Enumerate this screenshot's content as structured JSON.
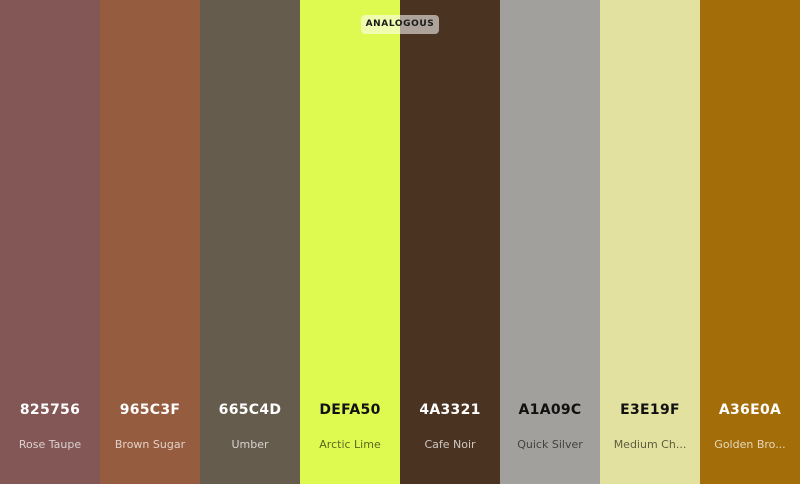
{
  "badge": {
    "label": "ANALOGOUS"
  },
  "swatches": [
    {
      "hex": "825756",
      "name": "Rose Taupe",
      "color": "#825756",
      "text": "#ffffff",
      "subtext": "rgba(255,255,255,0.72)"
    },
    {
      "hex": "965C3F",
      "name": "Brown Sugar",
      "color": "#965C3F",
      "text": "#ffffff",
      "subtext": "rgba(255,255,255,0.72)"
    },
    {
      "hex": "665C4D",
      "name": "Umber",
      "color": "#665C4D",
      "text": "#ffffff",
      "subtext": "rgba(255,255,255,0.72)"
    },
    {
      "hex": "DEFA50",
      "name": "Arctic Lime",
      "color": "#DEFA50",
      "text": "#111111",
      "subtext": "rgba(0,0,0,0.6)"
    },
    {
      "hex": "4A3321",
      "name": "Cafe Noir",
      "color": "#4A3321",
      "text": "#ffffff",
      "subtext": "rgba(255,255,255,0.72)"
    },
    {
      "hex": "A1A09C",
      "name": "Quick Silver",
      "color": "#A1A09C",
      "text": "#111111",
      "subtext": "rgba(0,0,0,0.6)"
    },
    {
      "hex": "E3E19F",
      "name": "Medium Ch...",
      "color": "#E3E19F",
      "text": "#111111",
      "subtext": "rgba(0,0,0,0.6)"
    },
    {
      "hex": "A36E0A",
      "name": "Golden Bro...",
      "color": "#A36E0A",
      "text": "#ffffff",
      "subtext": "rgba(255,255,255,0.72)"
    }
  ]
}
